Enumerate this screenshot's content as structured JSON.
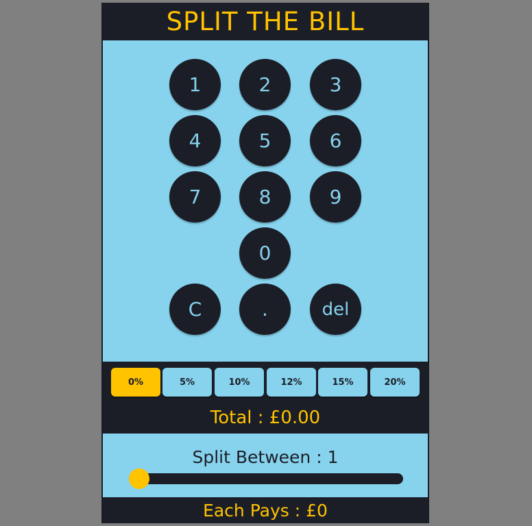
{
  "app": {
    "title": "SPLIT THE BILL"
  },
  "keypad": {
    "k1": "1",
    "k2": "2",
    "k3": "3",
    "k4": "4",
    "k5": "5",
    "k6": "6",
    "k7": "7",
    "k8": "8",
    "k9": "9",
    "k0": "0",
    "clear": "C",
    "dot": ".",
    "del": "del"
  },
  "tips": {
    "t0": "0%",
    "t5": "5%",
    "t10": "10%",
    "t12": "12%",
    "t15": "15%",
    "t20": "20%",
    "selected": "0%"
  },
  "total": {
    "text": "Total : £0.00"
  },
  "split": {
    "label": "Split Between : 1",
    "value": 1,
    "slider_fraction": 0
  },
  "each": {
    "text": "Each Pays : £0"
  },
  "colors": {
    "accent": "#ffc300",
    "dark": "#1b1e27",
    "light": "#87d3ee",
    "backdrop": "#808080"
  }
}
